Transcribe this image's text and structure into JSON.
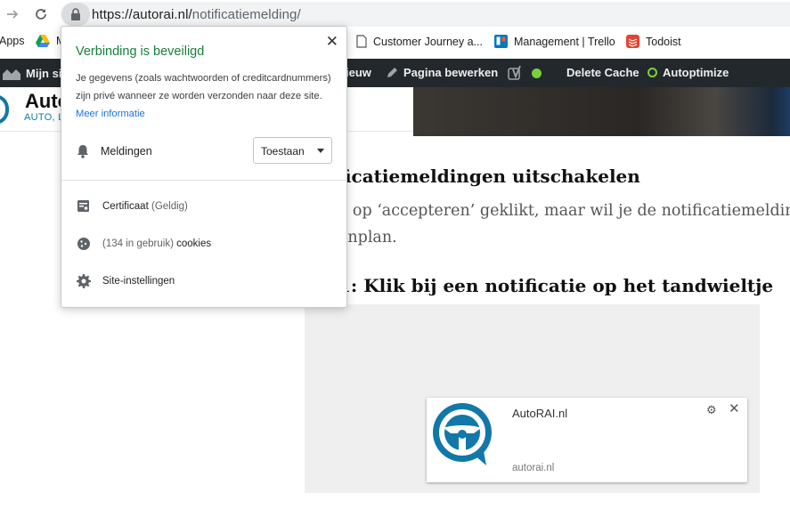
{
  "browser": {
    "back_icon": "arrow-right-icon",
    "reload_icon": "reload-icon",
    "url_host": "https://autorai.nl/",
    "url_path": "notificatiemelding/"
  },
  "bookmarks": {
    "apps_label": "Apps",
    "drive_label": "M",
    "items": [
      "Customer Journey a...",
      "Management | Trello",
      "Todoist"
    ]
  },
  "wp_admin": {
    "site_label": "Mijn sit",
    "new_label": "ieuw",
    "edit_label": "Pagina bewerken",
    "cache_label": "Delete Cache",
    "autoptimize_label": "Autoptimize"
  },
  "site": {
    "logo_text": "Auto",
    "logo_sub": "AUTO, L"
  },
  "article": {
    "heading": "ficatiemeldingen uitschakelen",
    "para_line1": "e op ‘accepteren’ geklikt, maar wil je de notificatiemeldingen",
    "para_line2": "enplan.",
    "step_heading": "1: Klik bij een notificatie op het tandwieltje"
  },
  "notification": {
    "title": "AutoRAI.nl",
    "site": "autorai.nl"
  },
  "popup": {
    "title": "Verbinding is beveiligd",
    "desc_text": "Je gegevens (zoals wachtwoorden of creditcardnummers) zijn privé wanneer ze worden verzonden naar deze site.",
    "more_info": "Meer informatie",
    "permission_label": "Meldingen",
    "permission_value": "Toestaan",
    "certificate_label": "Certificaat",
    "certificate_status": "(Geldig)",
    "cookies_count": "(134 in gebruik)",
    "cookies_label": "cookies",
    "site_settings_label": "Site-instellingen"
  },
  "colors": {
    "secure_green": "#188038",
    "link_blue": "#1a73e8",
    "wp_bar": "#23282d",
    "brand_blue": "#1178a8"
  }
}
